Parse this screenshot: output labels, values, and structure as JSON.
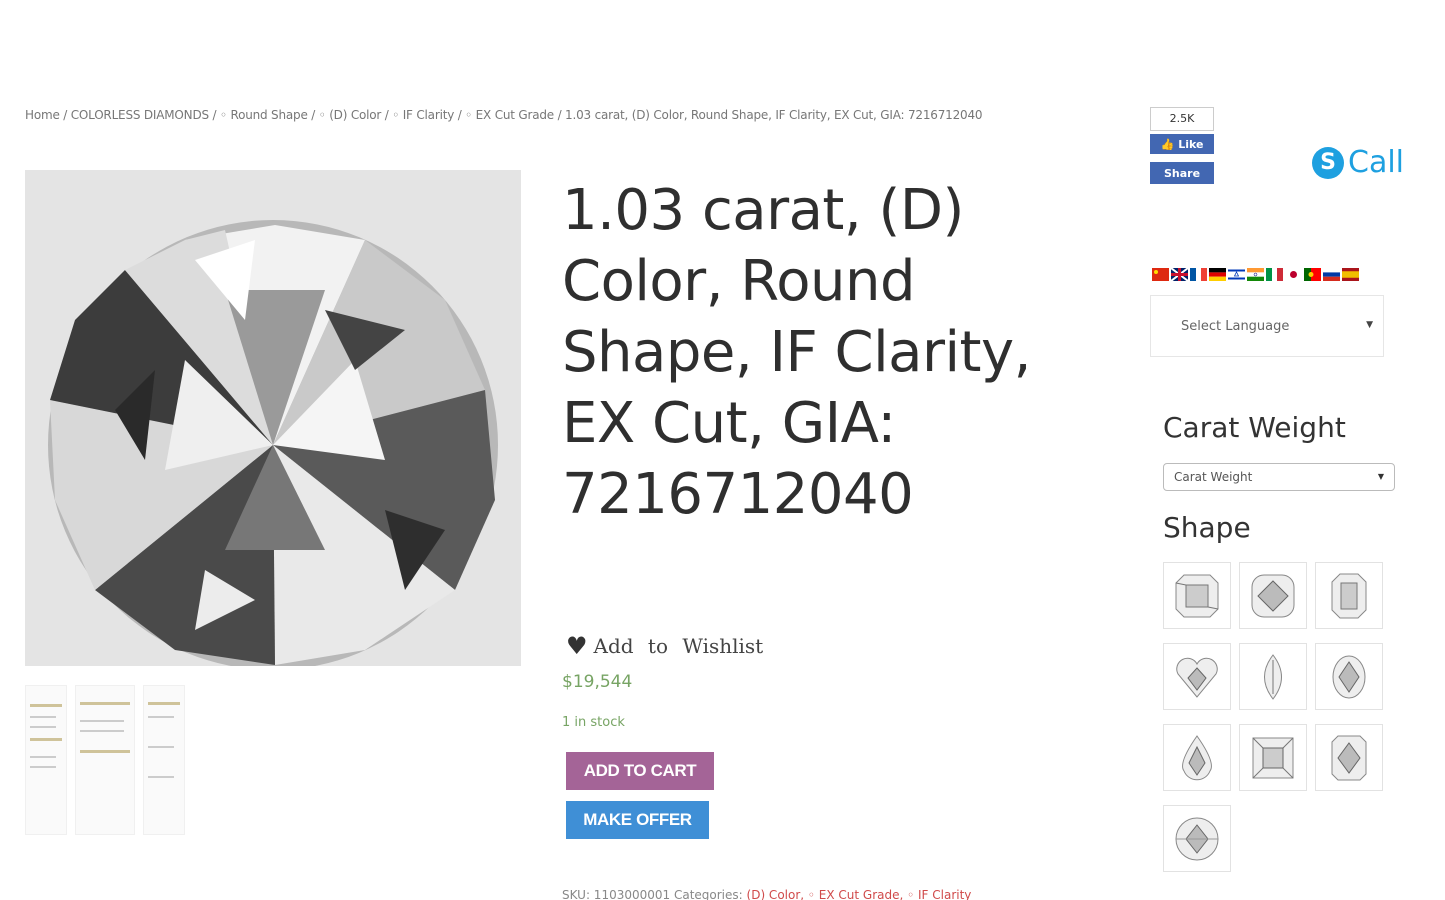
{
  "breadcrumb": {
    "text": "Home / COLORLESS DIAMONDS / ◦ Round Shape / ◦ (D) Color / ◦ IF Clarity / ◦ EX Cut Grade / 1.03 carat, (D) Color, Round Shape, IF Clarity, EX Cut, GIA: 7216712040"
  },
  "product": {
    "title": "1.03 carat, (D) Color, Round Shape, IF Clarity, EX Cut, GIA: 7216712040",
    "wishlist_label": "Add to Wishlist",
    "price": "$19,544",
    "stock": "1 in stock",
    "add_to_cart": "ADD TO CART",
    "make_offer": "MAKE OFFER",
    "meta_prefix": "SKU: 1103000001   Categories: ",
    "meta_categories": "(D) Color, ◦ EX Cut Grade, ◦ IF Clarity"
  },
  "social": {
    "count": "2.5K",
    "like": "Like",
    "share": "Share"
  },
  "call": {
    "label": "Call",
    "icon": "skype-icon"
  },
  "language": {
    "placeholder": "Select Language",
    "flags": [
      "china-flag",
      "uk-flag",
      "france-flag",
      "germany-flag",
      "israel-flag",
      "india-flag",
      "italy-flag",
      "japan-flag",
      "portugal-flag",
      "russia-flag",
      "spain-flag"
    ]
  },
  "filters": {
    "carat_title": "Carat Weight",
    "carat_select": "Carat Weight",
    "shape_title": "Shape",
    "shapes": [
      "asscher",
      "cushion",
      "emerald",
      "heart",
      "marquise",
      "oval",
      "pear",
      "princess",
      "radiant",
      "round"
    ]
  },
  "colors": {
    "cart_button": "#a46497",
    "offer_button": "#3f8fd6",
    "price": "#77a464",
    "facebook": "#4267b2",
    "skype": "#1ea0e0"
  }
}
